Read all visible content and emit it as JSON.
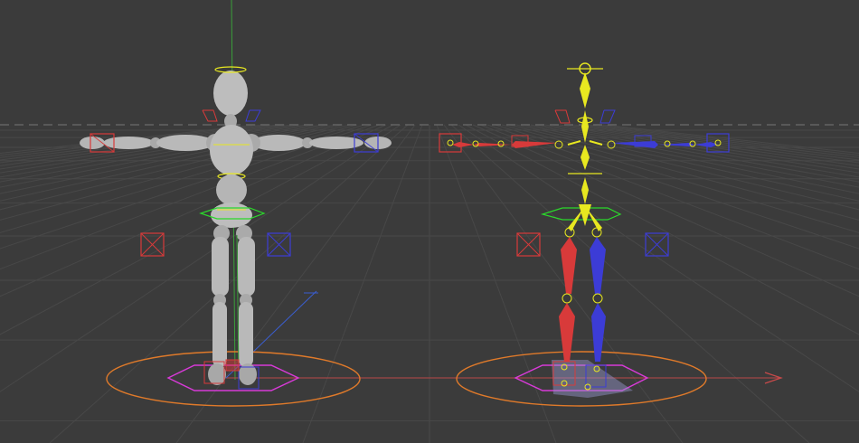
{
  "viewport": {
    "name": "3d-viewport",
    "background": "#3b3b3b"
  },
  "colors": {
    "grid_minor": "#464646",
    "grid_major": "#4d4d4d",
    "horizon": "#6a6a6a",
    "mannequin_body": "#b9b9b9",
    "mannequin_shade": "#8f8f8f",
    "left_controller": "#d83a3a",
    "right_controller": "#3c3cd6",
    "center_controller": "#e8e820",
    "root_ring": "#e07a2a",
    "ground_octagon": "#d83ad8",
    "pelvis_controller": "#2bd82b",
    "y_axis": "#3aa83a",
    "x_axis": "#c84a4a",
    "z_axis": "#3a6ad8"
  },
  "objects": {
    "mannequin": "mannequin-figure",
    "rig": "skeleton-rig"
  }
}
